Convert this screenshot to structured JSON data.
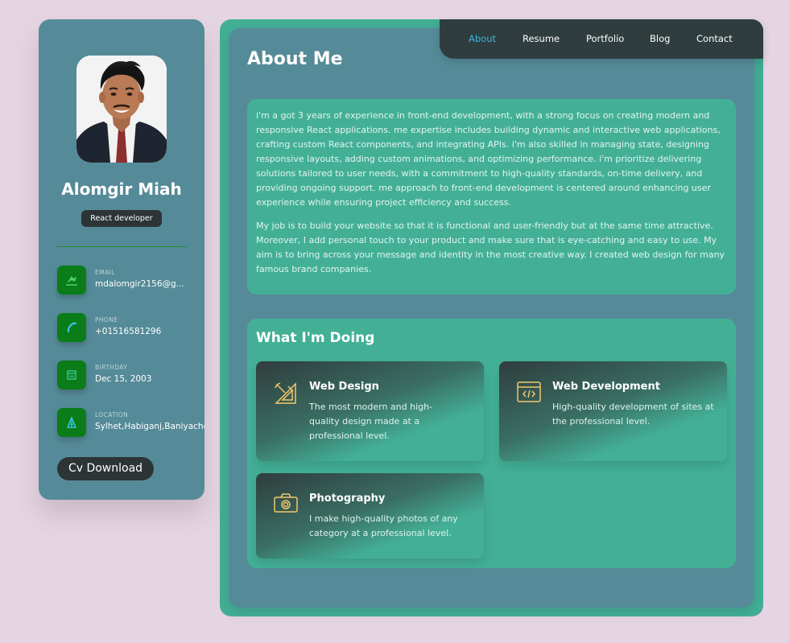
{
  "profile": {
    "name": "Alomgir Miah",
    "role": "React developer",
    "cv_button": "Cv Download",
    "contacts": [
      {
        "label": "EMAIL",
        "value": "mdalomgir2156@g...",
        "icon": "email-icon"
      },
      {
        "label": "PHONE",
        "value": "+01516581296",
        "icon": "phone-icon"
      },
      {
        "label": "BIRTHDAY",
        "value": "Dec 15, 2003",
        "icon": "calendar-icon"
      },
      {
        "label": "LOCATION",
        "value": "Sylhet,Habiganj,Baniyachong",
        "icon": "location-icon"
      }
    ]
  },
  "nav": {
    "items": [
      "About",
      "Resume",
      "Portfolio",
      "Blog",
      "Contact"
    ],
    "active": "About"
  },
  "about": {
    "title": "About Me",
    "paragraphs": [
      "i'm a got 3 years of experience in front-end development, with a strong focus on creating modern and responsive React applications. me expertise includes building dynamic and interactive web applications, crafting custom React components, and integrating APIs. i'm also skilled in managing state, designing responsive layouts, adding custom animations, and optimizing performance. i'm prioritize delivering solutions tailored to user needs, with a commitment to high-quality standards, on-time delivery, and providing ongoing support. me approach to front-end development is centered around enhancing user experience while ensuring project efficiency and success.",
      "My job is to build your website so that it is functional and user-friendly but at the same time attractive. Moreover, I add personal touch to your product and make sure that is eye-catching and easy to use. My aim is to bring across your message and identity in the most creative way. I created web design for many famous brand companies."
    ]
  },
  "doing": {
    "title": "What I'm Doing",
    "services": [
      {
        "title": "Web Design",
        "desc": "The most modern and high-quality design made at a professional level.",
        "icon": "design-icon"
      },
      {
        "title": "Web Development",
        "desc": "High-quality development of sites at the professional level.",
        "icon": "code-icon"
      },
      {
        "title": "Photography",
        "desc": "I make high-quality photos of any category at a professional level.",
        "icon": "camera-icon"
      }
    ]
  },
  "colors": {
    "background": "#e5d5e2",
    "panel": "#558b98",
    "accent": "#43b096",
    "dark": "#2f3d3f",
    "nav_active": "#3ab4e6",
    "icon_green": "#0a7c18",
    "service_icon": "#f2c86b"
  }
}
